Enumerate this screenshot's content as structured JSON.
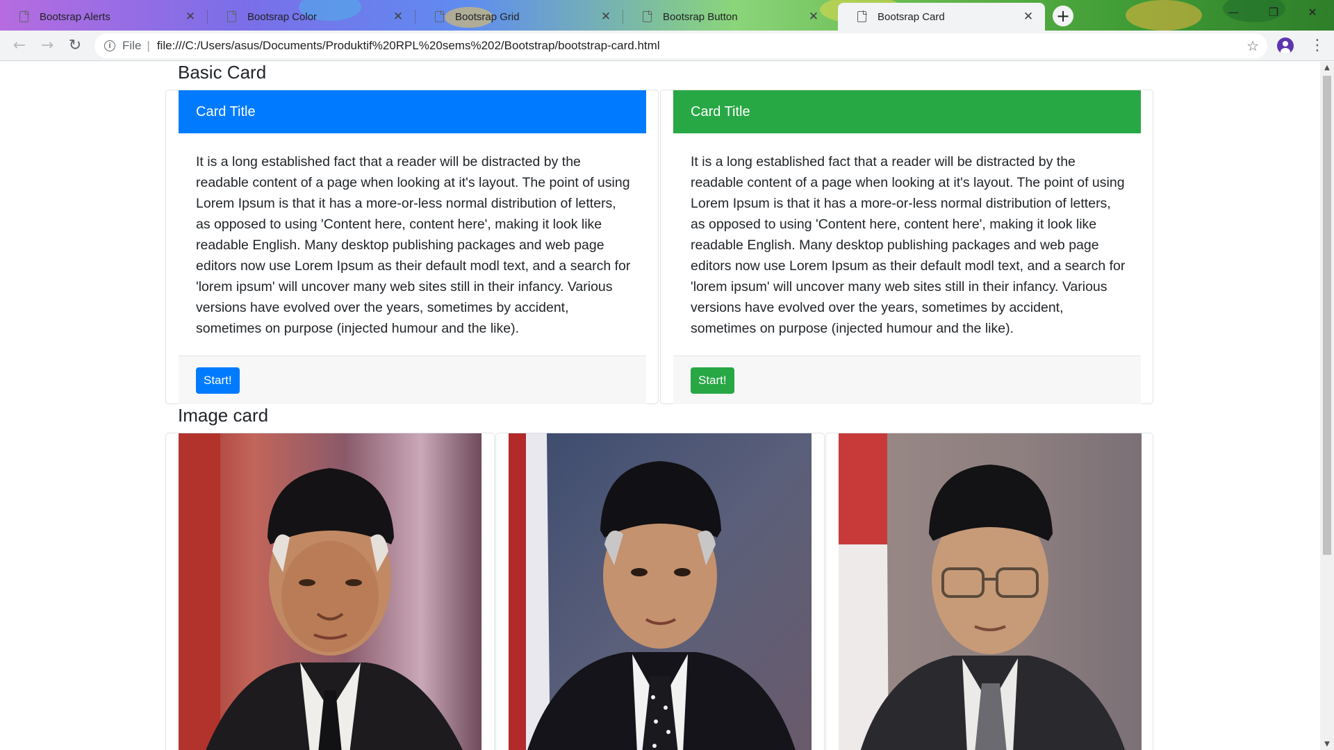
{
  "browser": {
    "tabs": [
      {
        "label": "Bootsrap Alerts",
        "active": false
      },
      {
        "label": "Bootsrap Color",
        "active": false
      },
      {
        "label": "Bootsrap Grid",
        "active": false
      },
      {
        "label": "Bootsrap Button",
        "active": false
      },
      {
        "label": "Bootsrap Card",
        "active": true
      }
    ],
    "new_tab_symbol": "+",
    "close_symbol": "✕",
    "url_scheme": "File",
    "url": "file:///C:/Users/asus/Documents/Produktif%20RPL%20sems%202/Bootstrap/bootstrap-card.html",
    "icons": [
      "back-icon",
      "forward-icon",
      "reload-icon",
      "info-icon",
      "star-icon",
      "profile-icon",
      "menu-icon",
      "minimize-icon",
      "maximize-icon",
      "close-window-icon"
    ]
  },
  "page": {
    "basic_heading": "Basic Card",
    "image_heading": "Image card",
    "cards": [
      {
        "title": "Card Title",
        "color": "#007bff",
        "body": "It is a long established fact that a reader will be distracted by the readable content of a page when looking at it's layout. The point of using Lorem Ipsum is that it has a more-or-less normal distribution of letters, as opposed to using 'Content here, content here', making it look like readable English. Many desktop publishing packages and web page editors now use Lorem Ipsum as their default modl text, and a search for 'lorem ipsum' will uncover many web sites still in their infancy. Various versions have evolved over the years, sometimes by accident, sometimes on purpose (injected humour and the like).",
        "button": "Start!"
      },
      {
        "title": "Card Title",
        "color": "#28a745",
        "body": "It is a long established fact that a reader will be distracted by the readable content of a page when looking at it's layout. The point of using Lorem Ipsum is that it has a more-or-less normal distribution of letters, as opposed to using 'Content here, content here', making it look like readable English. Many desktop publishing packages and web page editors now use Lorem Ipsum as their default modl text, and a search for 'lorem ipsum' will uncover many web sites still in their infancy. Various versions have evolved over the years, sometimes by accident, sometimes on purpose (injected humour and the like).",
        "button": "Start!"
      }
    ],
    "image_cards": [
      {
        "subject": "portrait-1"
      },
      {
        "subject": "portrait-2"
      },
      {
        "subject": "portrait-3"
      }
    ]
  }
}
